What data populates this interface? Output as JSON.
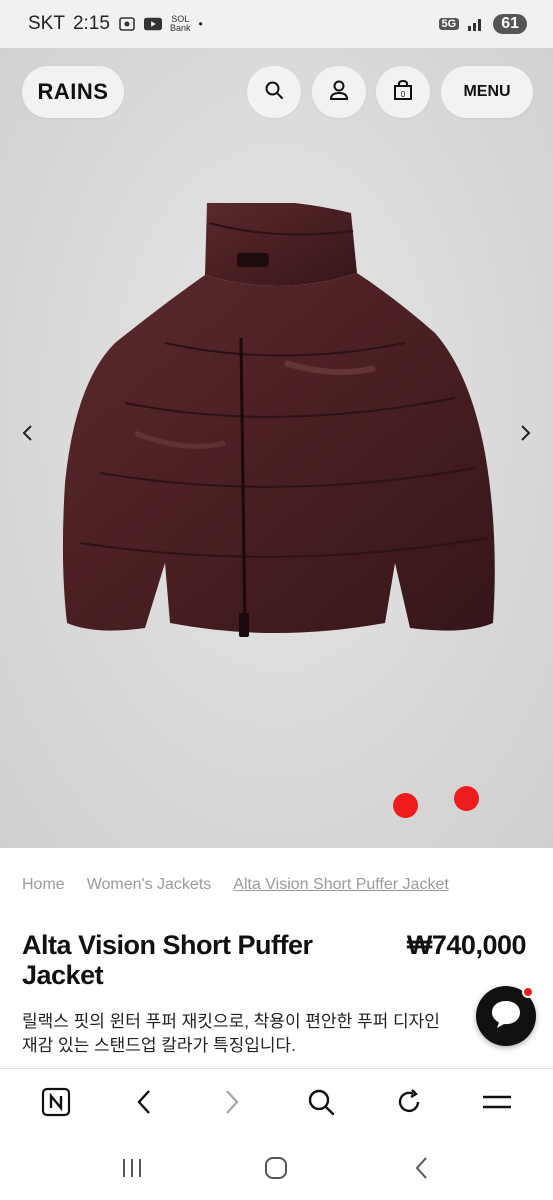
{
  "status_bar": {
    "carrier": "SKT",
    "time": "2:15",
    "sol_label": "SOL",
    "sol_sub": "Bank",
    "network": "5G",
    "battery": "61"
  },
  "header": {
    "logo": "RAINS",
    "menu_label": "MENU",
    "icons": [
      "search-icon",
      "account-icon",
      "bag-icon"
    ]
  },
  "gallery": {
    "dots": 2
  },
  "breadcrumb": {
    "items": [
      "Home",
      "Women's Jackets",
      "Alta Vision Short Puffer Jacket"
    ]
  },
  "product": {
    "title": "Alta Vision Short Puffer Jacket",
    "price": "₩740,000",
    "description_line1": "릴랙스 핏의 윈터 푸퍼 재킷으로, 착용이 편안한 푸퍼 디자인",
    "description_line2": "재감 있는 스탠드업 칼라가 특징입니다."
  },
  "colors": {
    "accent_red": "#ee1c1c",
    "jacket": "#4a1f22"
  },
  "browser_toolbar": {
    "icons": [
      "n-home-icon",
      "back-icon",
      "forward-icon",
      "search-icon",
      "refresh-icon",
      "menu-icon"
    ]
  },
  "system_nav": {
    "icons": [
      "recent-apps-icon",
      "home-icon",
      "back-icon"
    ]
  }
}
